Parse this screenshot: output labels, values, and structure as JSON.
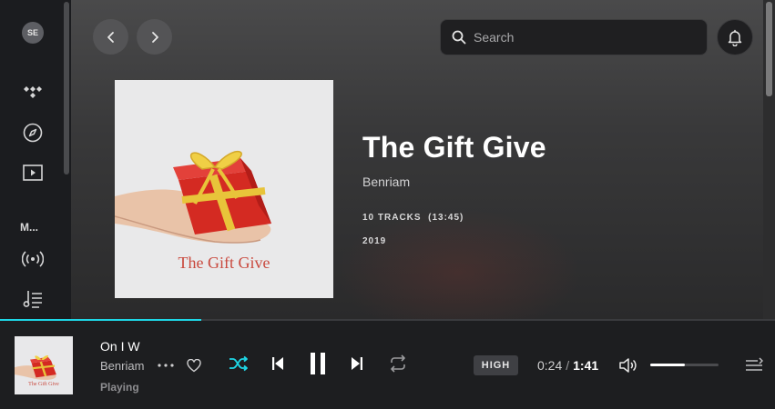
{
  "sidebar": {
    "avatar_initials": "SE",
    "section_label": "M...",
    "icons": [
      "tidal-logo-icon",
      "explore-compass-icon",
      "video-play-icon",
      "radio-broadcast-icon",
      "playlist-icon"
    ]
  },
  "header": {
    "back_icon": "chevron-left-icon",
    "forward_icon": "chevron-right-icon",
    "search_placeholder": "Search",
    "notifications_icon": "bell-icon"
  },
  "album": {
    "title": "The Gift Give",
    "artist": "Benriam",
    "tracks": "10 TRACKS  (13:45)",
    "year": "2019",
    "cover_text": "The Gift Give"
  },
  "player": {
    "track_name": "On I W",
    "artist": "Benriam",
    "status": "Playing",
    "quality": "HIGH",
    "elapsed": "0:24",
    "separator": "/",
    "duration": "1:41",
    "progress_fraction": 0.26,
    "volume_fraction": 0.5,
    "colors": {
      "accent": "#1ed7e6",
      "background": "#1d1e20"
    }
  }
}
